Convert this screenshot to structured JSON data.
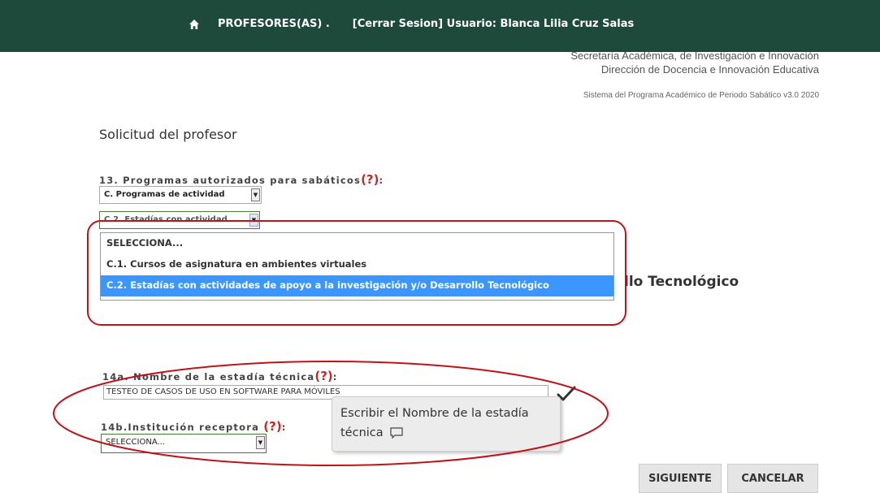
{
  "nav": {
    "professors": "PROFESORES(AS) .",
    "session": "[Cerrar Sesion] Usuario: Blanca Lilia Cruz Salas"
  },
  "header": {
    "line1": "Secretaría Académica, de Investigación e Innovación",
    "line2": "Dirección de Docencia e Innovación Educativa",
    "system": "Sistema del Programa Académico de Periodo Sabático v3.0 2020"
  },
  "form": {
    "title": "Solicitud del profesor",
    "q13": {
      "label": "13. Programas autorizados para sabáticos",
      "help": "(?)",
      "program_select": "C. Programas de actividad",
      "sub_select": "C.2. Estadías con actividad"
    },
    "dropdown": {
      "options": [
        "SELECCIONA...",
        "C.1. Cursos de asignatura en ambientes virtuales",
        "C.2. Estadías con actividades de apoyo a la investigación y/o Desarrollo Tecnológico"
      ],
      "selected_index": 2
    },
    "background_text": "llo Tecnológico",
    "q14a": {
      "label": "14a. Nombre de la estadía técnica",
      "help": "(?)",
      "value": "TESTEO DE CASOS DE USO EN SOFTWARE PARA MÓVILES"
    },
    "tooltip": "Escribir el Nombre de la estadía técnica",
    "q14b": {
      "label": "14b.Institución receptora",
      "help": "(?)",
      "select_value": "SELECCIONA..."
    },
    "buttons": {
      "next": "SIGUIENTE",
      "cancel": "CANCELAR"
    }
  },
  "colors": {
    "navbar": "#1d4a3b",
    "selected_option": "#3c96ff",
    "annotation": "#c0121b",
    "help": "#c62828"
  },
  "icons": [
    "home-icon",
    "checkmark-icon",
    "comment-icon",
    "chevron-down-icon"
  ]
}
